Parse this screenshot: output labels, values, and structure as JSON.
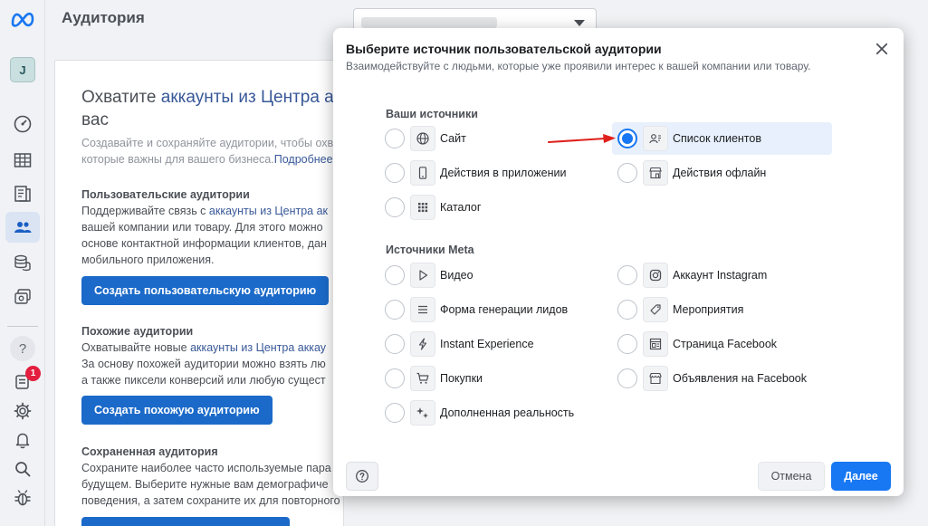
{
  "sidebar": {
    "avatar_letter": "J",
    "notification_count": "1",
    "help_glyph": "?"
  },
  "header": {
    "title": "Аудитория"
  },
  "panel": {
    "heading_prefix": "Охватите ",
    "heading_link": "аккаунты из Центра акк",
    "heading_suffix": "вас",
    "desc_line1": "Создавайте и сохраняйте аудитории, чтобы охв",
    "desc_line2": "которые важны для вашего бизнеса.",
    "desc_link": "Подробнее",
    "custom": {
      "title": "Пользовательские аудитории",
      "line1_prefix": "Поддерживайте связь с ",
      "line1_link": "аккаунты из Центра ак",
      "line2": "вашей компании или товару. Для этого можно",
      "line3": "основе контактной информации клиентов, дан",
      "line4": "мобильного приложения.",
      "button": "Создать пользовательскую аудиторию"
    },
    "lookalike": {
      "title": "Похожие аудитории",
      "line1_prefix": "Охватывайте новые ",
      "line1_link": "аккаунты из Центра аккау",
      "line2": "За основу похожей аудитории можно взять лю",
      "line3": "а также пиксели конверсий или любую сущест",
      "button": "Создать похожую аудиторию"
    },
    "saved": {
      "title": "Сохраненная аудитория",
      "line1": "Сохраните наиболее часто используемые пара",
      "line2": "будущем. Выберите нужные вам демографиче",
      "line3": "поведения, а затем сохраните их для повторного использования в рекламе в будущем."
    }
  },
  "modal": {
    "title": "Выберите источник пользовательской аудитории",
    "subtitle": "Взаимодействуйте с людьми, которые уже проявили интерес к вашей компании или товару.",
    "group_your": "Ваши источники",
    "group_meta": "Источники Meta",
    "options": {
      "site": "Сайт",
      "customer_list": "Список клиентов",
      "app_actions": "Действия в приложении",
      "offline_actions": "Действия офлайн",
      "catalog": "Каталог",
      "video": "Видео",
      "instagram": "Аккаунт Instagram",
      "lead_form": "Форма генерации лидов",
      "events": "Мероприятия",
      "instant_experience": "Instant Experience",
      "facebook_page": "Страница Facebook",
      "shopping": "Покупки",
      "facebook_listings": "Объявления на Facebook",
      "ar": "Дополненная реальность"
    },
    "selected_option": "customer_list",
    "cancel": "Отмена",
    "next": "Далее"
  },
  "colors": {
    "accent": "#1877f2",
    "arrow": "#e0201c",
    "badge": "#e41e3f"
  }
}
